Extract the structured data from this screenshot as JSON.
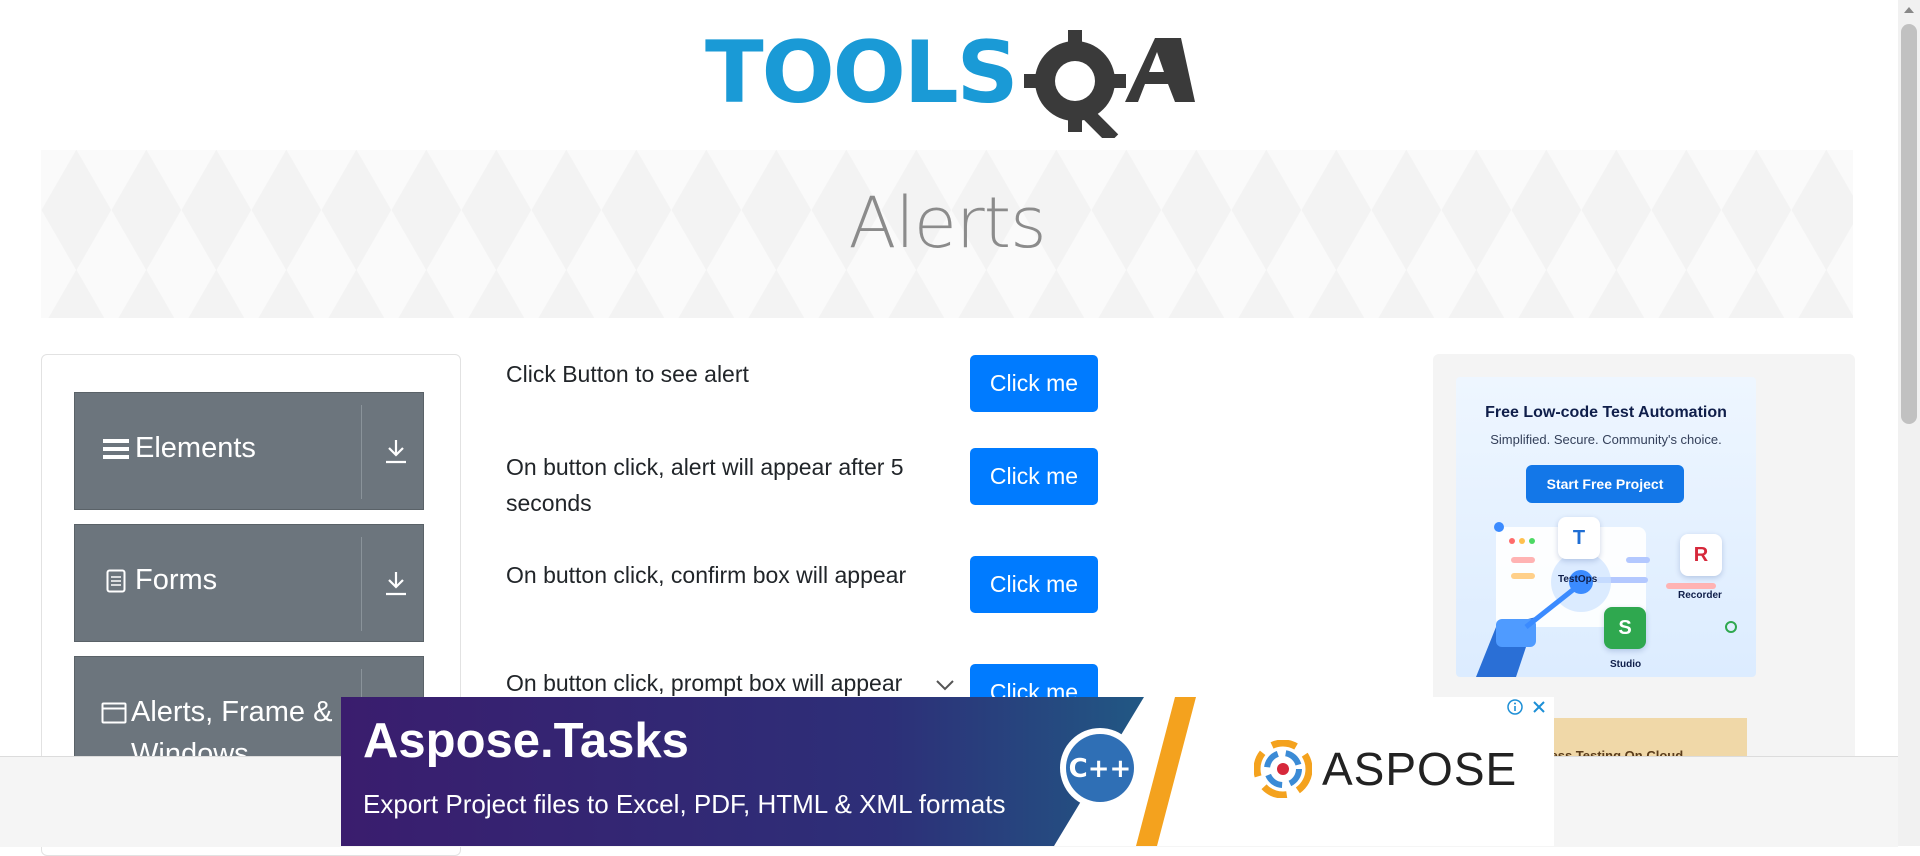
{
  "header": {
    "logo_text": "TOOLSQA"
  },
  "banner": {
    "title": "Alerts"
  },
  "sidebar": {
    "groups": [
      {
        "label": "Elements",
        "icon": "hamburger-icon"
      },
      {
        "label": "Forms",
        "icon": "form-icon"
      },
      {
        "label": "Alerts, Frame & Windows",
        "icon": "window-icon"
      }
    ]
  },
  "main": {
    "rows": [
      {
        "text": "Click Button to see alert",
        "button": "Click me"
      },
      {
        "text": "On button click, alert will appear after 5 seconds",
        "button": "Click me"
      },
      {
        "text": "On button click, confirm box will appear",
        "button": "Click me"
      },
      {
        "text": "On button click, prompt box will appear",
        "button": "Click me"
      }
    ]
  },
  "side_ad": {
    "title": "Free Low-code Test Automation",
    "subtitle": "Simplified. Secure. Community's choice.",
    "cta": "Start Free Project",
    "apps": [
      {
        "letter": "T",
        "label": "TestOps",
        "color": "#1f6ed4"
      },
      {
        "letter": "R",
        "label": "Recorder",
        "color": "#d6283b"
      },
      {
        "letter": "S",
        "label": "Studio",
        "color": "#2fa84f"
      }
    ],
    "second_ad_text": "Cypress Testing On Cloud"
  },
  "bottom_ad": {
    "title": "Aspose.Tasks",
    "subtitle": "Export Project files to Excel, PDF, HTML & XML formats",
    "brand": "ASPOSE",
    "cpp_label": "C++",
    "colors": {
      "brand_orange": "#f4a21e",
      "bg_start": "#3a1d6e",
      "bg_end": "#1b7c9c"
    }
  },
  "colors": {
    "primary_button": "#007bff",
    "sidebar_group": "#6c757d",
    "logo_blue": "#1a9ad6",
    "logo_dark": "#3a3a3a"
  }
}
